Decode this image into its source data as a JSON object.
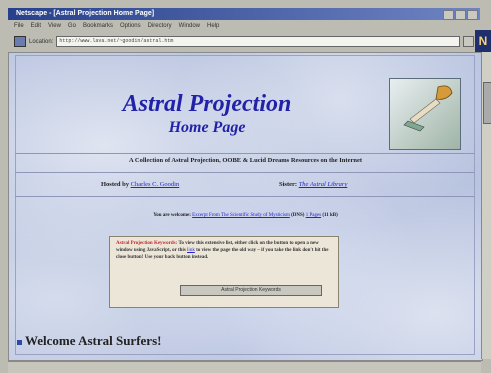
{
  "window": {
    "title": "Netscape - [Astral Projection Home Page]"
  },
  "menu": [
    "File",
    "Edit",
    "View",
    "Go",
    "Bookmarks",
    "Options",
    "Directory",
    "Window",
    "Help"
  ],
  "location": {
    "label": "Location:",
    "url": "http://www.lava.net/~goodin/astral.htm"
  },
  "page": {
    "title_line1": "Astral Projection",
    "title_line2": "Home Page",
    "subtitle": "A Collection of Astral Projection, OOBE & Lucid Dreams Resources on the Internet",
    "hosted_label": "Hosted by",
    "hosted_name": "Charles C. Goodin",
    "sister_label": "Sister:",
    "sister_name": "The Astral Library",
    "recommend_prefix": "You are welcome:",
    "recommend_link": "Excerpt From The Scientific Study of Mysticism",
    "recommend_mid": "(DNS)",
    "recommend_link2": "1 Pages",
    "recommend_suffix": "(11 kB)",
    "keywords_title": "Astral Projection Keywords:",
    "keywords_text1": "To view this extensive list, either click on the button to open a new window using JavaScript, or this",
    "keywords_link": "link",
    "keywords_text2": "to view the page the old way – if you take the link don't hit the close button! Use your back button instead.",
    "keywords_button": "Astral Projection Keywords",
    "welcome": "Welcome Astral Surfers!"
  }
}
